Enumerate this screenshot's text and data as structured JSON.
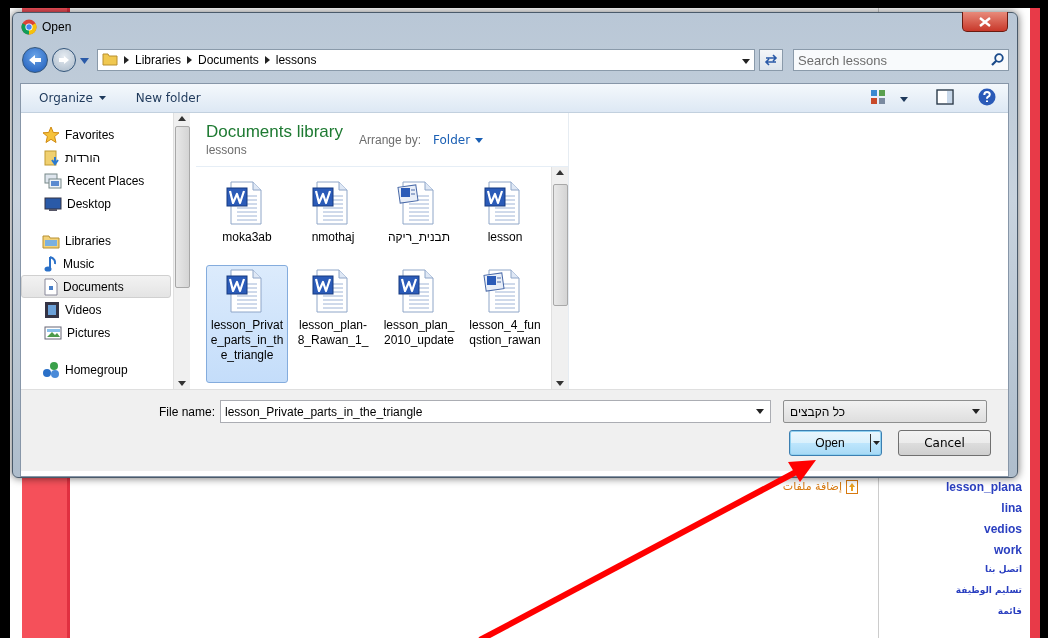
{
  "window": {
    "title": "Open"
  },
  "address_bar": {
    "path": [
      "Libraries",
      "Documents",
      "lessons"
    ]
  },
  "search": {
    "placeholder": "Search lessons"
  },
  "toolbar": [
    {
      "label": "Organize",
      "kind": "menu"
    },
    {
      "label": "New folder",
      "kind": "plain"
    }
  ],
  "nav": [
    {
      "label": "Favorites",
      "selected": false,
      "children": [
        {
          "label": "הורדות",
          "selected": false
        },
        {
          "label": "Recent Places",
          "selected": false
        },
        {
          "label": "Desktop",
          "selected": false
        }
      ]
    },
    {
      "label": "Libraries",
      "selected": false,
      "children": [
        {
          "label": "Music",
          "selected": false
        },
        {
          "label": "Documents",
          "selected": true
        },
        {
          "label": "Videos",
          "selected": false
        },
        {
          "label": "Pictures",
          "selected": false
        }
      ]
    },
    {
      "label": "Homegroup",
      "selected": false
    }
  ],
  "library": {
    "title": "Documents library",
    "subtitle": "lessons",
    "arrange_label": "Arrange by:",
    "arrange_value": "Folder"
  },
  "files": [
    {
      "name": "moka3ab",
      "kind": "docx",
      "selected": false
    },
    {
      "name": "nmothaj",
      "kind": "docx",
      "selected": false
    },
    {
      "name": "תבנית_ריקה",
      "kind": "doc",
      "selected": false
    },
    {
      "name": "lesson",
      "kind": "docx",
      "selected": false
    },
    {
      "name": "lesson_Private_parts_in_the_triangle",
      "kind": "docx",
      "selected": true
    },
    {
      "name": "lesson_plan-8_Rawan_1_",
      "kind": "docx",
      "selected": false
    },
    {
      "name": "lesson_plan_2010_update",
      "kind": "docx",
      "selected": false
    },
    {
      "name": "lesson_4_funqstion_rawan",
      "kind": "doc",
      "selected": false
    }
  ],
  "file_name": {
    "label": "File name:",
    "value": "lesson_Private_parts_in_the_triangle"
  },
  "file_type": {
    "value": "כל הקבצים"
  },
  "buttons": [
    {
      "label": "Open",
      "kind": "split"
    },
    {
      "label": "Cancel",
      "kind": "plain"
    }
  ],
  "background_page": {
    "attach_link": "إضافة ملفات",
    "sidebar_links": [
      {
        "label": "lesson_plana",
        "kind": "large"
      },
      {
        "label": "lina",
        "kind": "large"
      },
      {
        "label": "vedios",
        "kind": "large"
      },
      {
        "label": "work",
        "kind": "large"
      },
      {
        "label": "اتصل بنا",
        "kind": "small"
      },
      {
        "label": "تسليم الوظيفة",
        "kind": "small"
      },
      {
        "label": "قائمة",
        "kind": "small"
      }
    ]
  }
}
